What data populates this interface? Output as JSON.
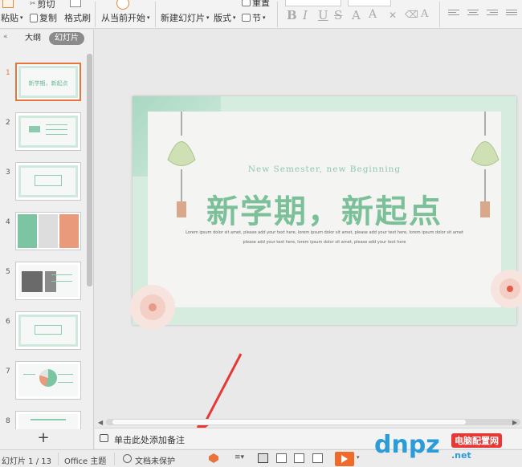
{
  "toolbar": {
    "paste": "粘贴",
    "cut": "剪切",
    "copy": "复制",
    "format_painter": "格式刷",
    "play_from_current": "从当前开始",
    "new_slide": "新建幻灯片",
    "layout": "版式",
    "section": "节",
    "reset": "重置",
    "format_bold": "B",
    "format_italic": "I",
    "format_underline": "U",
    "format_strike": "S",
    "format_superscript": "A",
    "format_clear": "A"
  },
  "left_panel": {
    "tabs": [
      "大纲",
      "幻灯片"
    ],
    "active_tab": "幻灯片",
    "add_button": "+",
    "thumbnails": [
      {
        "number": "1",
        "caption": "新学期，新起点"
      },
      {
        "number": "2"
      },
      {
        "number": "3"
      },
      {
        "number": "4"
      },
      {
        "number": "5"
      },
      {
        "number": "6"
      },
      {
        "number": "7"
      },
      {
        "number": "8"
      }
    ]
  },
  "slide": {
    "subtitle": "New Semester, new Beginning",
    "title": "新学期，新起点",
    "body_line1": "Lorem ipsum dolor sit amet, please add your text here, lorem ipsum dolor sit amet, please add your text here, lorem ipsum dolor sit amet",
    "body_line2": "please add your text here, lorem ipsum dolor sit amet, please add your text here"
  },
  "notes": {
    "placeholder": "单击此处添加备注"
  },
  "status_bar": {
    "slide_counter": "幻灯片 1 / 13",
    "theme": "Office 主题",
    "protection": "文档未保护"
  },
  "watermark": {
    "brand": "dnpz",
    "suffix": ".net",
    "site_name": "电脑配置网"
  },
  "colors": {
    "accent_green": "#7cc09a",
    "selection_orange": "#e8743b",
    "arrow_red": "#e53935",
    "play_orange": "#f06a2a"
  }
}
